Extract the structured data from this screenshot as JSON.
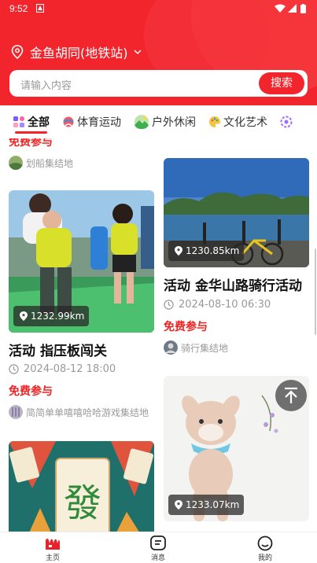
{
  "status_bar": {
    "time": "9:52"
  },
  "header": {
    "location": "金鱼胡同(地铁站)",
    "search_placeholder": "请输入内容",
    "search_button": "搜索",
    "accent_color": "#f2242c"
  },
  "tabs": [
    {
      "label": "全部",
      "icon": "grid-icon",
      "active": true
    },
    {
      "label": "体育运动",
      "icon": "sports-icon"
    },
    {
      "label": "户外休闲",
      "icon": "outdoor-icon"
    },
    {
      "label": "文化艺术",
      "icon": "culture-icon"
    }
  ],
  "feed": {
    "left": [
      {
        "partial_title": "免费参与",
        "organizer": "划船集结地"
      },
      {
        "distance": "1232.99km",
        "tag": "活动",
        "title": "指压板闯关",
        "datetime": "2024-08-12 18:00",
        "price": "免费参与",
        "organizer": "简简单单嘻嘻哈哈游戏集结地"
      },
      {
        "image": "mahjong-poster"
      }
    ],
    "right": [
      {
        "distance": "1230.85km",
        "tag": "活动",
        "title": "金华山路骑行活动",
        "datetime": "2024-08-10 06:30",
        "price": "免费参与",
        "organizer": "骑行集结地"
      },
      {
        "distance": "1233.07km",
        "image": "crochet-deer"
      }
    ]
  },
  "bottom_nav": [
    {
      "label": "主页",
      "icon": "home-icon",
      "active": true
    },
    {
      "label": "消息",
      "icon": "message-icon"
    },
    {
      "label": "我的",
      "icon": "profile-icon"
    }
  ]
}
